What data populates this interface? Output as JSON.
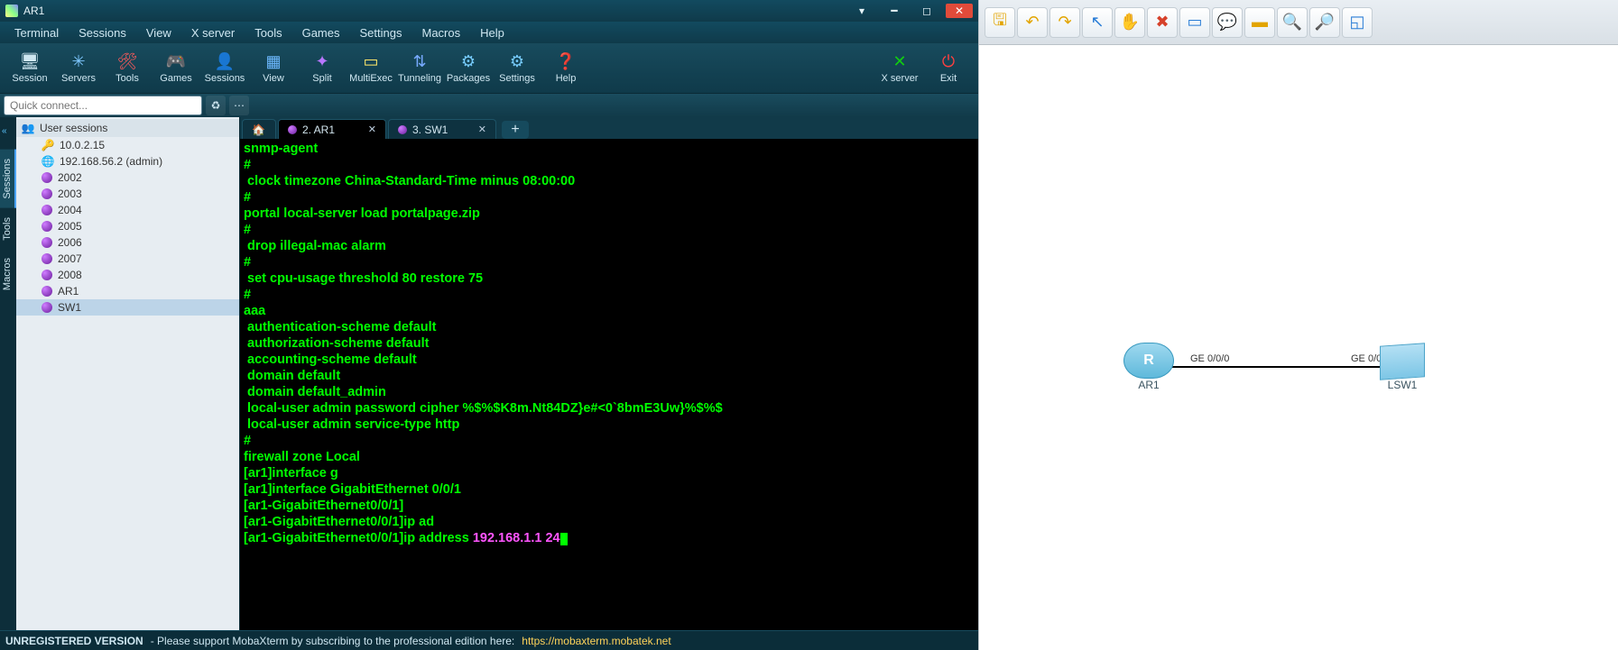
{
  "titlebar": {
    "title": "AR1"
  },
  "menus": [
    "Terminal",
    "Sessions",
    "View",
    "X server",
    "Tools",
    "Games",
    "Settings",
    "Macros",
    "Help"
  ],
  "toolbar": [
    {
      "id": "session",
      "label": "Session",
      "icon": "ico-session"
    },
    {
      "id": "servers",
      "label": "Servers",
      "icon": "ico-servers"
    },
    {
      "id": "tools",
      "label": "Tools",
      "icon": "ico-tools"
    },
    {
      "id": "games",
      "label": "Games",
      "icon": "ico-games"
    },
    {
      "id": "sessions",
      "label": "Sessions",
      "icon": "ico-sess2"
    },
    {
      "id": "view",
      "label": "View",
      "icon": "ico-view"
    },
    {
      "id": "split",
      "label": "Split",
      "icon": "ico-split"
    },
    {
      "id": "multiexec",
      "label": "MultiExec",
      "icon": "ico-multi"
    },
    {
      "id": "tunneling",
      "label": "Tunneling",
      "icon": "ico-tunnel"
    },
    {
      "id": "packages",
      "label": "Packages",
      "icon": "ico-pkg"
    },
    {
      "id": "settings",
      "label": "Settings",
      "icon": "ico-settings"
    },
    {
      "id": "help",
      "label": "Help",
      "icon": "ico-help"
    }
  ],
  "toolbar_right": [
    {
      "id": "xserver",
      "label": "X server",
      "icon": "ico-x"
    },
    {
      "id": "exit",
      "label": "Exit",
      "icon": "ico-exit"
    }
  ],
  "quick_placeholder": "Quick connect...",
  "side_tabs": [
    {
      "id": "sessions",
      "label": "Sessions",
      "active": true
    },
    {
      "id": "tools",
      "label": "Tools",
      "active": false
    },
    {
      "id": "macros",
      "label": "Macros",
      "active": false
    }
  ],
  "tree_header": "User sessions",
  "tree": [
    {
      "icon": "key",
      "label": "10.0.2.15"
    },
    {
      "icon": "globe",
      "label": "192.168.56.2 (admin)"
    },
    {
      "icon": "dot",
      "label": "2002"
    },
    {
      "icon": "dot",
      "label": "2003"
    },
    {
      "icon": "dot",
      "label": "2004"
    },
    {
      "icon": "dot",
      "label": "2005"
    },
    {
      "icon": "dot",
      "label": "2006"
    },
    {
      "icon": "dot",
      "label": "2007"
    },
    {
      "icon": "dot",
      "label": "2008"
    },
    {
      "icon": "dot",
      "label": "AR1"
    },
    {
      "icon": "dot",
      "label": "SW1",
      "selected": true
    }
  ],
  "tabs": [
    {
      "id": "home",
      "label": "",
      "home": true
    },
    {
      "id": "ar1",
      "label": "2. AR1",
      "active": true,
      "closable": true
    },
    {
      "id": "sw1",
      "label": "3. SW1",
      "closable": true
    }
  ],
  "terminal_lines": [
    {
      "t": "snmp-agent"
    },
    {
      "t": "#"
    },
    {
      "t": " clock timezone China-Standard-Time minus 08:00:00"
    },
    {
      "t": "#"
    },
    {
      "t": "portal local-server load portalpage.zip"
    },
    {
      "t": "#"
    },
    {
      "t": " drop illegal-mac alarm"
    },
    {
      "t": "#"
    },
    {
      "t": " set cpu-usage threshold 80 restore 75"
    },
    {
      "t": "#"
    },
    {
      "t": "aaa"
    },
    {
      "t": " authentication-scheme default"
    },
    {
      "t": " authorization-scheme default"
    },
    {
      "t": " accounting-scheme default"
    },
    {
      "t": " domain default"
    },
    {
      "t": " domain default_admin"
    },
    {
      "t": " local-user admin password cipher %$%$K8m.Nt84DZ}e#<0`8bmE3Uw}%$%$"
    },
    {
      "t": " local-user admin service-type http"
    },
    {
      "t": "#"
    },
    {
      "t": "firewall zone Local"
    },
    {
      "t": ""
    },
    {
      "t": "[ar1]interface g"
    },
    {
      "t": "[ar1]interface GigabitEthernet 0/0/1"
    },
    {
      "t": "[ar1-GigabitEthernet0/0/1]"
    },
    {
      "t": "[ar1-GigabitEthernet0/0/1]ip ad"
    },
    {
      "prefix": "[ar1-GigabitEthernet0/0/1]ip address ",
      "mag": "192.168.1.1 24",
      "cursor": true
    }
  ],
  "status": {
    "unreg": "UNREGISTERED VERSION",
    "text": " -  Please support MobaXterm by subscribing to the professional edition here:  ",
    "link": "https://mobaxterm.mobatek.net"
  },
  "topo_tools": [
    {
      "id": "save",
      "glyph": "🖫",
      "cls": "y"
    },
    {
      "id": "undo",
      "glyph": "↶",
      "cls": "y"
    },
    {
      "id": "redo",
      "glyph": "↷",
      "cls": "y"
    },
    {
      "id": "pointer",
      "glyph": "↖",
      "cls": "b"
    },
    {
      "id": "hand",
      "glyph": "✋",
      "cls": "y"
    },
    {
      "id": "delete",
      "glyph": "✖",
      "cls": "r"
    },
    {
      "id": "dev",
      "glyph": "▭",
      "cls": "b"
    },
    {
      "id": "text",
      "glyph": "💬",
      "cls": "b"
    },
    {
      "id": "rect",
      "glyph": "▬",
      "cls": "y"
    },
    {
      "id": "zoomin",
      "glyph": "🔍",
      "cls": "g"
    },
    {
      "id": "zoomout",
      "glyph": "🔎",
      "cls": "g"
    },
    {
      "id": "fit",
      "glyph": "◱",
      "cls": "b"
    }
  ],
  "topo": {
    "router_label": "AR1",
    "switch_label": "LSW1",
    "link_left": "GE 0/0/0",
    "link_right": "GE 0/0/1"
  }
}
